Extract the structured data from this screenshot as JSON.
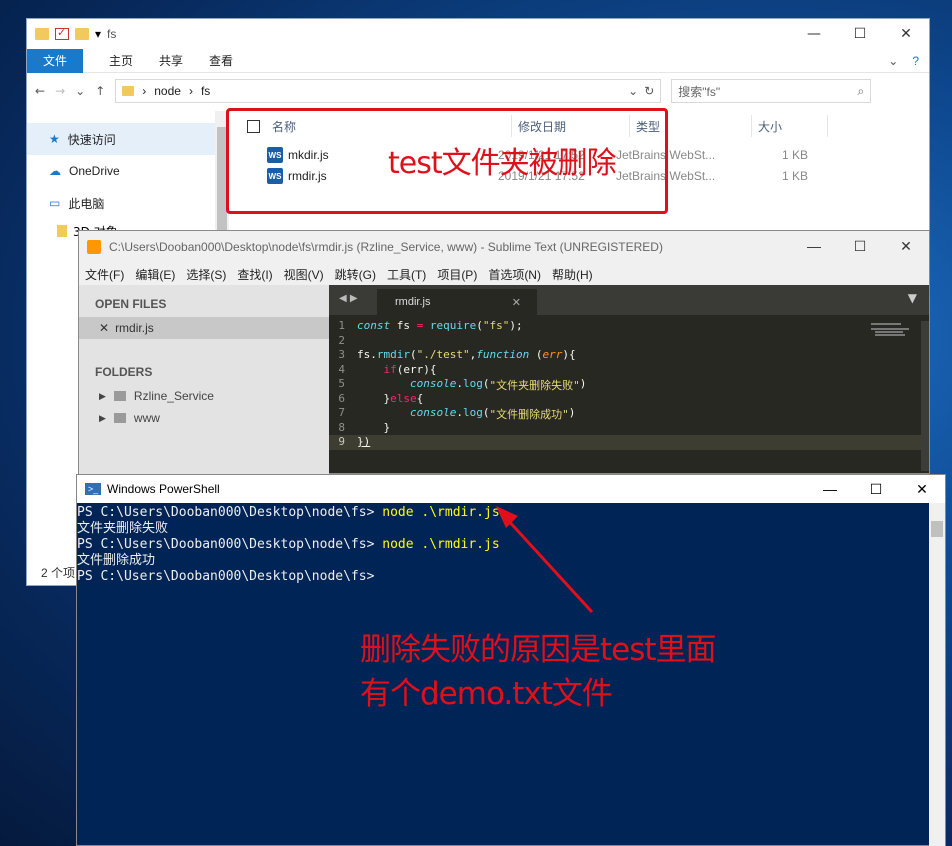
{
  "explorer": {
    "title": "fs",
    "ribbon_tabs": [
      "文件",
      "主页",
      "共享",
      "查看"
    ],
    "breadcrumb": [
      "node",
      "fs"
    ],
    "search_placeholder": "搜索\"fs\"",
    "nav": [
      {
        "label": "快速访问",
        "icon": "star-icon"
      },
      {
        "label": "OneDrive",
        "icon": "cloud-icon"
      },
      {
        "label": "此电脑",
        "icon": "pc-icon"
      }
    ],
    "nav_sub": [
      "3D 对象"
    ],
    "columns": [
      "名称",
      "修改日期",
      "类型",
      "大小"
    ],
    "files": [
      {
        "name": "mkdir.js",
        "date": "2019/1/21 17:52",
        "type": "JetBrains WebSt...",
        "size": "1 KB"
      },
      {
        "name": "rmdir.js",
        "date": "2019/1/21 17:52",
        "type": "JetBrains WebSt...",
        "size": "1 KB"
      }
    ],
    "status": "2 个项"
  },
  "annotation_top": "test文件夹被删除",
  "sublime": {
    "title": "C:\\Users\\Dooban000\\Desktop\\node\\fs\\rmdir.js (Rzline_Service, www) - Sublime Text (UNREGISTERED)",
    "menu": [
      "文件(F)",
      "编辑(E)",
      "选择(S)",
      "查找(I)",
      "视图(V)",
      "跳转(G)",
      "工具(T)",
      "项目(P)",
      "首选项(N)",
      "帮助(H)"
    ],
    "open_files_header": "OPEN FILES",
    "open_file": "rmdir.js",
    "folders_header": "FOLDERS",
    "folders": [
      "Rzline_Service",
      "www"
    ],
    "tab": "rmdir.js",
    "line_numbers": [
      "1",
      "2",
      "3",
      "4",
      "5",
      "6",
      "7",
      "8",
      "9"
    ]
  },
  "powershell": {
    "title": "Windows PowerShell",
    "prompt": "PS C:\\Users\\Dooban000\\Desktop\\node\\fs> ",
    "cmd": "node .\\rmdir.js",
    "out1": "文件夹删除失败",
    "out2": "文件删除成功"
  },
  "annotation_bottom": [
    "删除失败的原因是test里面",
    "有个demo.txt文件"
  ],
  "colors": {
    "annotation": "#e0101a",
    "ps_bg": "#012456",
    "editor_bg": "#272822",
    "accent": "#1979ca"
  }
}
